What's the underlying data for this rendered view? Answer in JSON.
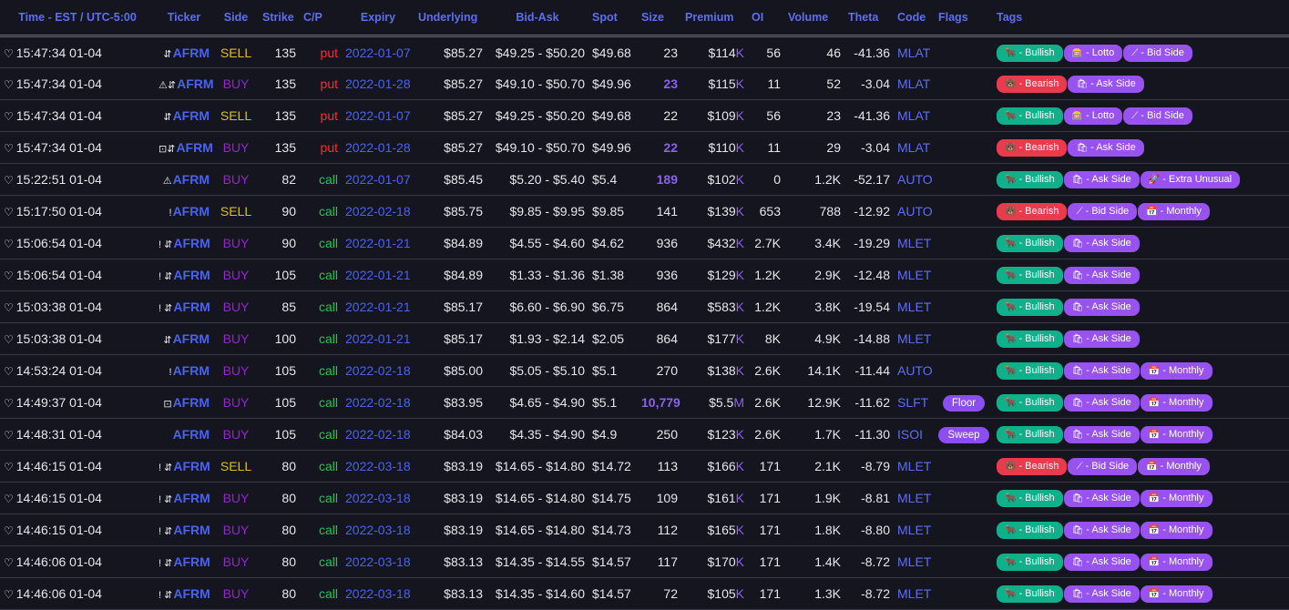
{
  "headers": [
    "Time - EST / UTC-5:00",
    "Ticker",
    "Side",
    "Strike",
    "C/P",
    "Expiry",
    "Underlying",
    "Bid-Ask",
    "Spot",
    "Size",
    "Premium",
    "OI",
    "Volume",
    "Theta",
    "Code",
    "Flags",
    "Tags"
  ],
  "colors": {
    "accent": "#5d6ff0",
    "buy": "#9225c7",
    "sell": "#d7c01f",
    "put": "#ff2b2b",
    "call": "#23c552",
    "bullish": "#0fb08a",
    "bearish": "#ea3b4d",
    "tag": "#9852f0"
  },
  "rows": [
    {
      "time": "15:47:34 01-04",
      "icons": "⇵",
      "ticker": "AFRM",
      "side": "SELL",
      "strike": "135",
      "cp": "put",
      "expiry": "2022-01-07",
      "underlying": "$85.27",
      "bidask": "$49.25 - $50.20",
      "spot": "$49.68",
      "size": "23",
      "size_hi": false,
      "premium": "$114",
      "unit": "K",
      "oi": "56",
      "volume": "46",
      "theta": "-41.36",
      "code": "MLAT",
      "flag": "",
      "tags": [
        {
          "icon": "bull-icon",
          "glyph": "🐂",
          "label": "- Bullish",
          "kind": "bullish"
        },
        {
          "icon": "lotto-icon",
          "glyph": "🎰",
          "label": "- Lotto",
          "kind": "purple"
        },
        {
          "icon": "wand-icon",
          "glyph": "⟋",
          "label": "- Bid Side",
          "kind": "purple"
        }
      ]
    },
    {
      "time": "15:47:34 01-04",
      "icons": "⚠⇵",
      "ticker": "AFRM",
      "side": "BUY",
      "strike": "135",
      "cp": "put",
      "expiry": "2022-01-28",
      "underlying": "$85.27",
      "bidask": "$49.10 - $50.70",
      "spot": "$49.96",
      "size": "23",
      "size_hi": true,
      "premium": "$115",
      "unit": "K",
      "oi": "11",
      "volume": "52",
      "theta": "-3.04",
      "code": "MLAT",
      "flag": "",
      "tags": [
        {
          "icon": "bear-icon",
          "glyph": "🐻",
          "label": "- Bearish",
          "kind": "bearish"
        },
        {
          "icon": "bag-icon",
          "glyph": "🛍",
          "label": "- Ask Side",
          "kind": "purple"
        }
      ]
    },
    {
      "time": "15:47:34 01-04",
      "icons": "⇵",
      "ticker": "AFRM",
      "side": "SELL",
      "strike": "135",
      "cp": "put",
      "expiry": "2022-01-07",
      "underlying": "$85.27",
      "bidask": "$49.25 - $50.20",
      "spot": "$49.68",
      "size": "22",
      "size_hi": false,
      "premium": "$109",
      "unit": "K",
      "oi": "56",
      "volume": "23",
      "theta": "-41.36",
      "code": "MLAT",
      "flag": "",
      "tags": [
        {
          "icon": "bull-icon",
          "glyph": "🐂",
          "label": "- Bullish",
          "kind": "bullish"
        },
        {
          "icon": "lotto-icon",
          "glyph": "🎰",
          "label": "- Lotto",
          "kind": "purple"
        },
        {
          "icon": "wand-icon",
          "glyph": "⟋",
          "label": "- Bid Side",
          "kind": "purple"
        }
      ]
    },
    {
      "time": "15:47:34 01-04",
      "icons": "⊡⇵",
      "ticker": "AFRM",
      "side": "BUY",
      "strike": "135",
      "cp": "put",
      "expiry": "2022-01-28",
      "underlying": "$85.27",
      "bidask": "$49.10 - $50.70",
      "spot": "$49.96",
      "size": "22",
      "size_hi": true,
      "premium": "$110",
      "unit": "K",
      "oi": "11",
      "volume": "29",
      "theta": "-3.04",
      "code": "MLAT",
      "flag": "",
      "tags": [
        {
          "icon": "bear-icon",
          "glyph": "🐻",
          "label": "- Bearish",
          "kind": "bearish"
        },
        {
          "icon": "bag-icon",
          "glyph": "🛍",
          "label": "- Ask Side",
          "kind": "purple"
        }
      ]
    },
    {
      "time": "15:22:51 01-04",
      "icons": "⚠",
      "ticker": "AFRM",
      "side": "BUY",
      "strike": "82",
      "cp": "call",
      "expiry": "2022-01-07",
      "underlying": "$85.45",
      "bidask": "$5.20 - $5.40",
      "spot": "$5.4",
      "size": "189",
      "size_hi": true,
      "premium": "$102",
      "unit": "K",
      "oi": "0",
      "volume": "1.2K",
      "theta": "-52.17",
      "code": "AUTO",
      "flag": "",
      "tags": [
        {
          "icon": "bull-icon",
          "glyph": "🐂",
          "label": "- Bullish",
          "kind": "bullish"
        },
        {
          "icon": "bag-icon",
          "glyph": "🛍",
          "label": "- Ask Side",
          "kind": "purple"
        },
        {
          "icon": "rocket-icon",
          "glyph": "🚀",
          "label": "- Extra Unusual",
          "kind": "purple"
        }
      ]
    },
    {
      "time": "15:17:50 01-04",
      "icons": "!",
      "ticker": "AFRM",
      "side": "SELL",
      "strike": "90",
      "cp": "call",
      "expiry": "2022-02-18",
      "underlying": "$85.75",
      "bidask": "$9.85 - $9.95",
      "spot": "$9.85",
      "size": "141",
      "size_hi": false,
      "premium": "$139",
      "unit": "K",
      "oi": "653",
      "volume": "788",
      "theta": "-12.92",
      "code": "AUTO",
      "flag": "",
      "tags": [
        {
          "icon": "bear-icon",
          "glyph": "🐻",
          "label": "- Bearish",
          "kind": "bearish"
        },
        {
          "icon": "wand-icon",
          "glyph": "⟋",
          "label": "- Bid Side",
          "kind": "purple"
        },
        {
          "icon": "calendar-icon",
          "glyph": "📅",
          "label": "- Monthly",
          "kind": "purple"
        }
      ]
    },
    {
      "time": "15:06:54 01-04",
      "icons": "! ⇵",
      "ticker": "AFRM",
      "side": "BUY",
      "strike": "90",
      "cp": "call",
      "expiry": "2022-01-21",
      "underlying": "$84.89",
      "bidask": "$4.55 - $4.60",
      "spot": "$4.62",
      "size": "936",
      "size_hi": false,
      "premium": "$432",
      "unit": "K",
      "oi": "2.7K",
      "volume": "3.4K",
      "theta": "-19.29",
      "code": "MLET",
      "flag": "",
      "tags": [
        {
          "icon": "bull-icon",
          "glyph": "🐂",
          "label": "- Bullish",
          "kind": "bullish"
        },
        {
          "icon": "bag-icon",
          "glyph": "🛍",
          "label": "- Ask Side",
          "kind": "purple"
        }
      ]
    },
    {
      "time": "15:06:54 01-04",
      "icons": "! ⇵",
      "ticker": "AFRM",
      "side": "BUY",
      "strike": "105",
      "cp": "call",
      "expiry": "2022-01-21",
      "underlying": "$84.89",
      "bidask": "$1.33 - $1.36",
      "spot": "$1.38",
      "size": "936",
      "size_hi": false,
      "premium": "$129",
      "unit": "K",
      "oi": "1.2K",
      "volume": "2.9K",
      "theta": "-12.48",
      "code": "MLET",
      "flag": "",
      "tags": [
        {
          "icon": "bull-icon",
          "glyph": "🐂",
          "label": "- Bullish",
          "kind": "bullish"
        },
        {
          "icon": "bag-icon",
          "glyph": "🛍",
          "label": "- Ask Side",
          "kind": "purple"
        }
      ]
    },
    {
      "time": "15:03:38 01-04",
      "icons": "! ⇵",
      "ticker": "AFRM",
      "side": "BUY",
      "strike": "85",
      "cp": "call",
      "expiry": "2022-01-21",
      "underlying": "$85.17",
      "bidask": "$6.60 - $6.90",
      "spot": "$6.75",
      "size": "864",
      "size_hi": false,
      "premium": "$583",
      "unit": "K",
      "oi": "1.2K",
      "volume": "3.8K",
      "theta": "-19.54",
      "code": "MLET",
      "flag": "",
      "tags": [
        {
          "icon": "bull-icon",
          "glyph": "🐂",
          "label": "- Bullish",
          "kind": "bullish"
        },
        {
          "icon": "bag-icon",
          "glyph": "🛍",
          "label": "- Ask Side",
          "kind": "purple"
        }
      ]
    },
    {
      "time": "15:03:38 01-04",
      "icons": "⇵",
      "ticker": "AFRM",
      "side": "BUY",
      "strike": "100",
      "cp": "call",
      "expiry": "2022-01-21",
      "underlying": "$85.17",
      "bidask": "$1.93 - $2.14",
      "spot": "$2.05",
      "size": "864",
      "size_hi": false,
      "premium": "$177",
      "unit": "K",
      "oi": "8K",
      "volume": "4.9K",
      "theta": "-14.88",
      "code": "MLET",
      "flag": "",
      "tags": [
        {
          "icon": "bull-icon",
          "glyph": "🐂",
          "label": "- Bullish",
          "kind": "bullish"
        },
        {
          "icon": "bag-icon",
          "glyph": "🛍",
          "label": "- Ask Side",
          "kind": "purple"
        }
      ]
    },
    {
      "time": "14:53:24 01-04",
      "icons": "!",
      "ticker": "AFRM",
      "side": "BUY",
      "strike": "105",
      "cp": "call",
      "expiry": "2022-02-18",
      "underlying": "$85.00",
      "bidask": "$5.05 - $5.10",
      "spot": "$5.1",
      "size": "270",
      "size_hi": false,
      "premium": "$138",
      "unit": "K",
      "oi": "2.6K",
      "volume": "14.1K",
      "theta": "-11.44",
      "code": "AUTO",
      "flag": "",
      "tags": [
        {
          "icon": "bull-icon",
          "glyph": "🐂",
          "label": "- Bullish",
          "kind": "bullish"
        },
        {
          "icon": "bag-icon",
          "glyph": "🛍",
          "label": "- Ask Side",
          "kind": "purple"
        },
        {
          "icon": "calendar-icon",
          "glyph": "📅",
          "label": "- Monthly",
          "kind": "purple"
        }
      ]
    },
    {
      "time": "14:49:37 01-04",
      "icons": "⊡",
      "ticker": "AFRM",
      "side": "BUY",
      "strike": "105",
      "cp": "call",
      "expiry": "2022-02-18",
      "underlying": "$83.95",
      "bidask": "$4.65 - $4.90",
      "spot": "$5.1",
      "size": "10,779",
      "size_hi": true,
      "premium": "$5.5",
      "unit": "M",
      "oi": "2.6K",
      "volume": "12.9K",
      "theta": "-11.62",
      "code": "SLFT",
      "flag": "Floor",
      "tags": [
        {
          "icon": "bull-icon",
          "glyph": "🐂",
          "label": "- Bullish",
          "kind": "bullish"
        },
        {
          "icon": "bag-icon",
          "glyph": "🛍",
          "label": "- Ask Side",
          "kind": "purple"
        },
        {
          "icon": "calendar-icon",
          "glyph": "📅",
          "label": "- Monthly",
          "kind": "purple"
        }
      ]
    },
    {
      "time": "14:48:31 01-04",
      "icons": "",
      "ticker": "AFRM",
      "side": "BUY",
      "strike": "105",
      "cp": "call",
      "expiry": "2022-02-18",
      "underlying": "$84.03",
      "bidask": "$4.35 - $4.90",
      "spot": "$4.9",
      "size": "250",
      "size_hi": false,
      "premium": "$123",
      "unit": "K",
      "oi": "2.6K",
      "volume": "1.7K",
      "theta": "-11.30",
      "code": "ISOI",
      "flag": "Sweep",
      "tags": [
        {
          "icon": "bull-icon",
          "glyph": "🐂",
          "label": "- Bullish",
          "kind": "bullish"
        },
        {
          "icon": "bag-icon",
          "glyph": "🛍",
          "label": "- Ask Side",
          "kind": "purple"
        },
        {
          "icon": "calendar-icon",
          "glyph": "📅",
          "label": "- Monthly",
          "kind": "purple"
        }
      ]
    },
    {
      "time": "14:46:15 01-04",
      "icons": "! ⇵",
      "ticker": "AFRM",
      "side": "SELL",
      "strike": "80",
      "cp": "call",
      "expiry": "2022-03-18",
      "underlying": "$83.19",
      "bidask": "$14.65 - $14.80",
      "spot": "$14.72",
      "size": "113",
      "size_hi": false,
      "premium": "$166",
      "unit": "K",
      "oi": "171",
      "volume": "2.1K",
      "theta": "-8.79",
      "code": "MLET",
      "flag": "",
      "tags": [
        {
          "icon": "bear-icon",
          "glyph": "🐻",
          "label": "- Bearish",
          "kind": "bearish"
        },
        {
          "icon": "wand-icon",
          "glyph": "⟋",
          "label": "- Bid Side",
          "kind": "purple"
        },
        {
          "icon": "calendar-icon",
          "glyph": "📅",
          "label": "- Monthly",
          "kind": "purple"
        }
      ]
    },
    {
      "time": "14:46:15 01-04",
      "icons": "! ⇵",
      "ticker": "AFRM",
      "side": "BUY",
      "strike": "80",
      "cp": "call",
      "expiry": "2022-03-18",
      "underlying": "$83.19",
      "bidask": "$14.65 - $14.80",
      "spot": "$14.75",
      "size": "109",
      "size_hi": false,
      "premium": "$161",
      "unit": "K",
      "oi": "171",
      "volume": "1.9K",
      "theta": "-8.81",
      "code": "MLET",
      "flag": "",
      "tags": [
        {
          "icon": "bull-icon",
          "glyph": "🐂",
          "label": "- Bullish",
          "kind": "bullish"
        },
        {
          "icon": "bag-icon",
          "glyph": "🛍",
          "label": "- Ask Side",
          "kind": "purple"
        },
        {
          "icon": "calendar-icon",
          "glyph": "📅",
          "label": "- Monthly",
          "kind": "purple"
        }
      ]
    },
    {
      "time": "14:46:15 01-04",
      "icons": "! ⇵",
      "ticker": "AFRM",
      "side": "BUY",
      "strike": "80",
      "cp": "call",
      "expiry": "2022-03-18",
      "underlying": "$83.19",
      "bidask": "$14.65 - $14.80",
      "spot": "$14.73",
      "size": "112",
      "size_hi": false,
      "premium": "$165",
      "unit": "K",
      "oi": "171",
      "volume": "1.8K",
      "theta": "-8.80",
      "code": "MLET",
      "flag": "",
      "tags": [
        {
          "icon": "bull-icon",
          "glyph": "🐂",
          "label": "- Bullish",
          "kind": "bullish"
        },
        {
          "icon": "bag-icon",
          "glyph": "🛍",
          "label": "- Ask Side",
          "kind": "purple"
        },
        {
          "icon": "calendar-icon",
          "glyph": "📅",
          "label": "- Monthly",
          "kind": "purple"
        }
      ]
    },
    {
      "time": "14:46:06 01-04",
      "icons": "! ⇵",
      "ticker": "AFRM",
      "side": "BUY",
      "strike": "80",
      "cp": "call",
      "expiry": "2022-03-18",
      "underlying": "$83.13",
      "bidask": "$14.35 - $14.55",
      "spot": "$14.57",
      "size": "117",
      "size_hi": false,
      "premium": "$170",
      "unit": "K",
      "oi": "171",
      "volume": "1.4K",
      "theta": "-8.72",
      "code": "MLET",
      "flag": "",
      "tags": [
        {
          "icon": "bull-icon",
          "glyph": "🐂",
          "label": "- Bullish",
          "kind": "bullish"
        },
        {
          "icon": "bag-icon",
          "glyph": "🛍",
          "label": "- Ask Side",
          "kind": "purple"
        },
        {
          "icon": "calendar-icon",
          "glyph": "📅",
          "label": "- Monthly",
          "kind": "purple"
        }
      ]
    },
    {
      "time": "14:46:06 01-04",
      "icons": "! ⇵",
      "ticker": "AFRM",
      "side": "BUY",
      "strike": "80",
      "cp": "call",
      "expiry": "2022-03-18",
      "underlying": "$83.13",
      "bidask": "$14.35 - $14.60",
      "spot": "$14.57",
      "size": "72",
      "size_hi": false,
      "premium": "$105",
      "unit": "K",
      "oi": "171",
      "volume": "1.3K",
      "theta": "-8.72",
      "code": "MLET",
      "flag": "",
      "tags": [
        {
          "icon": "bull-icon",
          "glyph": "🐂",
          "label": "- Bullish",
          "kind": "bullish"
        },
        {
          "icon": "bag-icon",
          "glyph": "🛍",
          "label": "- Ask Side",
          "kind": "purple"
        },
        {
          "icon": "calendar-icon",
          "glyph": "📅",
          "label": "- Monthly",
          "kind": "purple"
        }
      ]
    }
  ]
}
